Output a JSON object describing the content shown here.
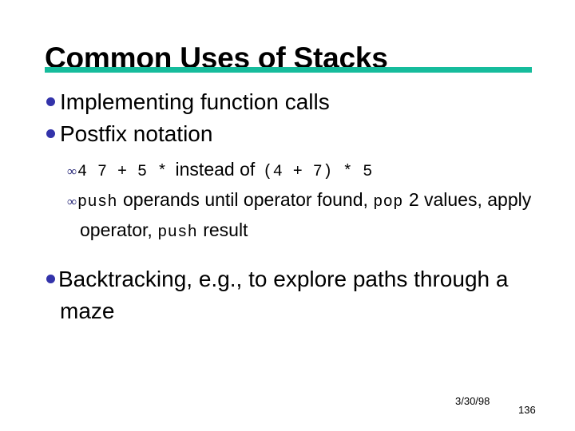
{
  "slide": {
    "title": "Common Uses of Stacks",
    "rule_color": "#16bc9c",
    "bullet_color": "#3333aa",
    "sub_bullet_color": "#2b2b7a",
    "background_color": "#ffffff",
    "text_color": "#000000",
    "bullet_glyph": "•",
    "sub_bullet_glyph": "∞"
  },
  "bullets": {
    "item1": "Implementing function calls",
    "item2": "Postfix notation",
    "item3_line1": "Backtracking, e.g., to explore paths",
    "item3_line2": "through a maze",
    "item3_full": "Backtracking, e.g., to explore paths through a maze"
  },
  "subbullets": {
    "sub1": {
      "code_before": "4 7 + 5 *",
      "middle": "instead of",
      "code_after": "(4 + 7) * 5",
      "full": "4 7 + 5 *  instead of  (4 + 7) * 5"
    },
    "sub2": {
      "code1": "push",
      "text1": "operands until operator found,",
      "code2": "pop",
      "text2": "2 values, apply operator,",
      "code3": "push",
      "text3": "result",
      "full": "push operands until operator found, pop 2 values, apply operator, push result"
    }
  },
  "footer": {
    "date": "3/30/98",
    "slide_number": "136"
  }
}
